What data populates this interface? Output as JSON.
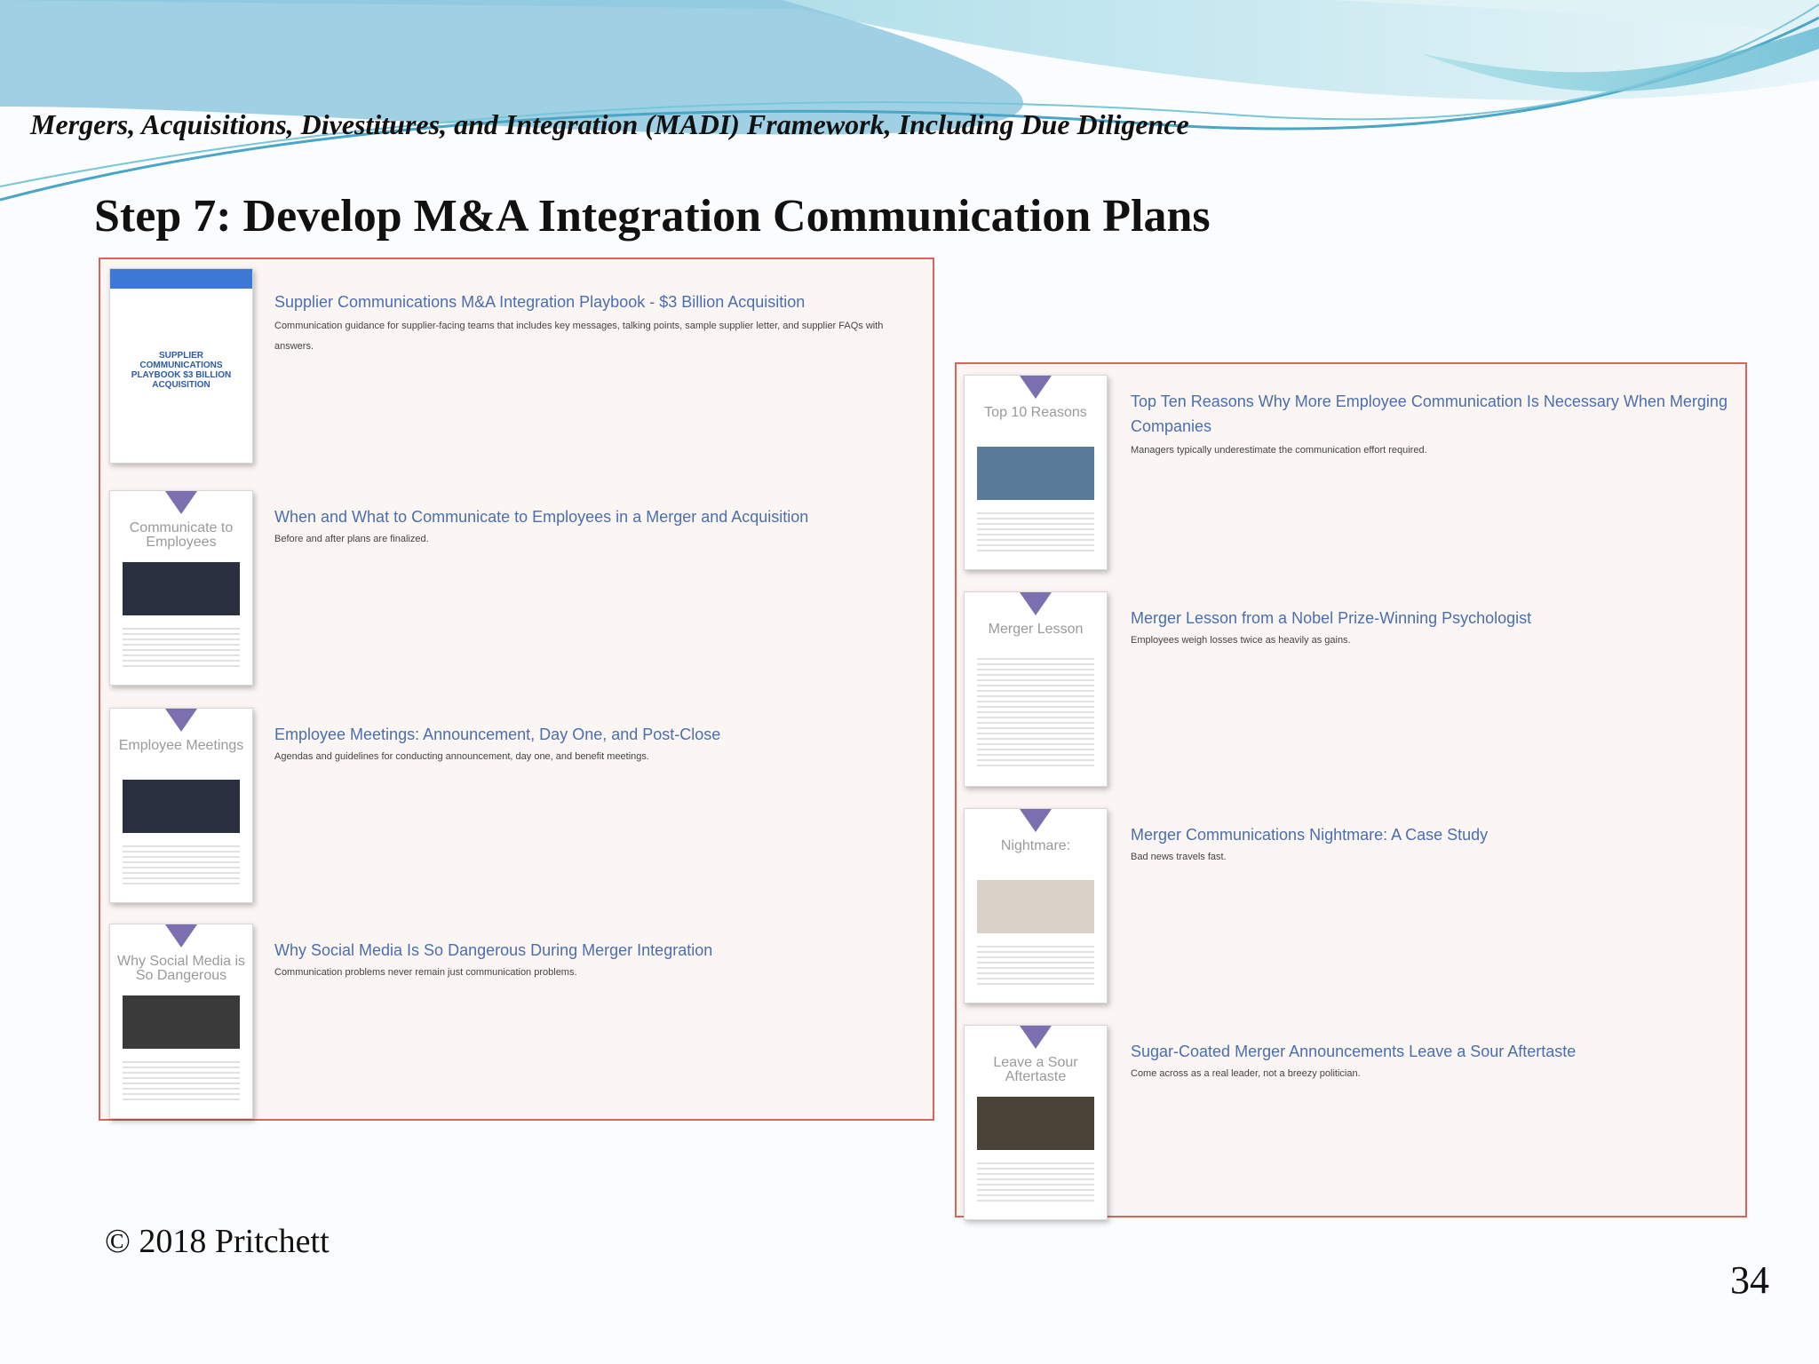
{
  "header": {
    "framework_title": "Mergers, Acquisitions, Divestitures, and Integration (MADI) Framework, Including Due Diligence"
  },
  "slide": {
    "title": "Step 7: Develop M&A Integration Communication Plans"
  },
  "colors": {
    "panel_border": "#d9655a",
    "link": "#4a6fb0",
    "accent_triangle": "#7b6fb0",
    "wave": "#6ec3d8"
  },
  "left_panel": {
    "items": [
      {
        "thumb_title": "SUPPLIER COMMUNICATIONS PLAYBOOK $3 BILLION ACQUISITION",
        "title": "Supplier Communications M&A Integration Playbook - $3 Billion Acquisition",
        "description": "Communication guidance for supplier-facing teams that includes key messages, talking points, sample supplier letter, and supplier FAQs with answers."
      },
      {
        "thumb_title": "Communicate to Employees",
        "title": "When and What to Communicate to Employees in a Merger and Acquisition",
        "description": "Before and after plans are finalized."
      },
      {
        "thumb_title": "Employee Meetings",
        "title": "Employee Meetings: Announcement, Day One, and Post-Close",
        "description": "Agendas and guidelines for conducting announcement, day one, and benefit meetings."
      },
      {
        "thumb_title": "Why Social Media is So Dangerous",
        "title": "Why Social Media Is So Dangerous During Merger Integration",
        "description": "Communication problems never remain just communication problems."
      }
    ]
  },
  "right_panel": {
    "items": [
      {
        "thumb_title": "Top 10 Reasons",
        "title": "Top Ten Reasons Why More Employee Communication Is Necessary When Merging Companies",
        "description": "Managers typically underestimate the communication effort required."
      },
      {
        "thumb_title": "Merger Lesson",
        "title": "Merger Lesson from a Nobel Prize-Winning Psychologist",
        "description": "Employees weigh losses twice as heavily as gains."
      },
      {
        "thumb_title": "Nightmare:",
        "title": "Merger Communications Nightmare: A Case Study",
        "description": "Bad news travels fast."
      },
      {
        "thumb_title": "Leave a Sour Aftertaste",
        "title": "Sugar-Coated Merger Announcements Leave a Sour Aftertaste",
        "description": "Come across as a real leader, not a breezy politician."
      }
    ]
  },
  "footer": {
    "copyright": "© 2018 Pritchett",
    "page_number": "34"
  }
}
